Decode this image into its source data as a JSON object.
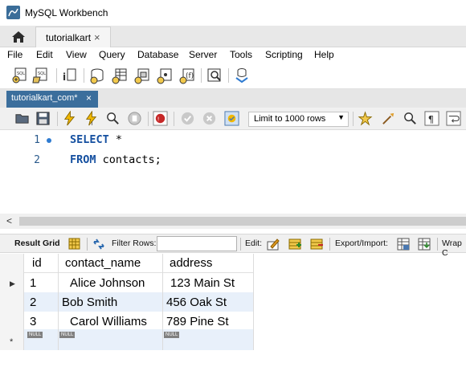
{
  "window": {
    "title": "MySQL Workbench"
  },
  "connection_tab": {
    "label": "tutorialkart",
    "close": "×"
  },
  "menu": [
    {
      "label": "File"
    },
    {
      "label": "Edit"
    },
    {
      "label": "View"
    },
    {
      "label": "Query"
    },
    {
      "label": "Database"
    },
    {
      "label": "Server"
    },
    {
      "label": "Tools"
    },
    {
      "label": "Scripting"
    },
    {
      "label": "Help"
    }
  ],
  "query_tab": {
    "label": "tutorialkart_com*",
    "close": "×"
  },
  "sql_toolbar": {
    "limit_label": "Limit to 1000 rows"
  },
  "editor": {
    "lines": [
      {
        "num": "1",
        "keyword": "SELECT",
        "rest": " *"
      },
      {
        "num": "2",
        "keyword": "FROM",
        "rest": " contacts;"
      }
    ]
  },
  "result_toolbar": {
    "result_grid": "Result Grid",
    "filter_rows": "Filter Rows:",
    "edit": "Edit:",
    "export_import": "Export/Import:",
    "wrap": "Wrap C"
  },
  "grid": {
    "columns": [
      "id",
      "contact_name",
      "address"
    ],
    "rows": [
      {
        "id": "1",
        "contact_name": "Alice Johnson",
        "address": "123 Main St"
      },
      {
        "id": "2",
        "contact_name": "Bob Smith",
        "address": "456 Oak St"
      },
      {
        "id": "3",
        "contact_name": "Carol Williams",
        "address": "789 Pine St"
      }
    ],
    "null_label": "NULL",
    "current_row_marker": "▶",
    "new_row_marker": "*"
  }
}
